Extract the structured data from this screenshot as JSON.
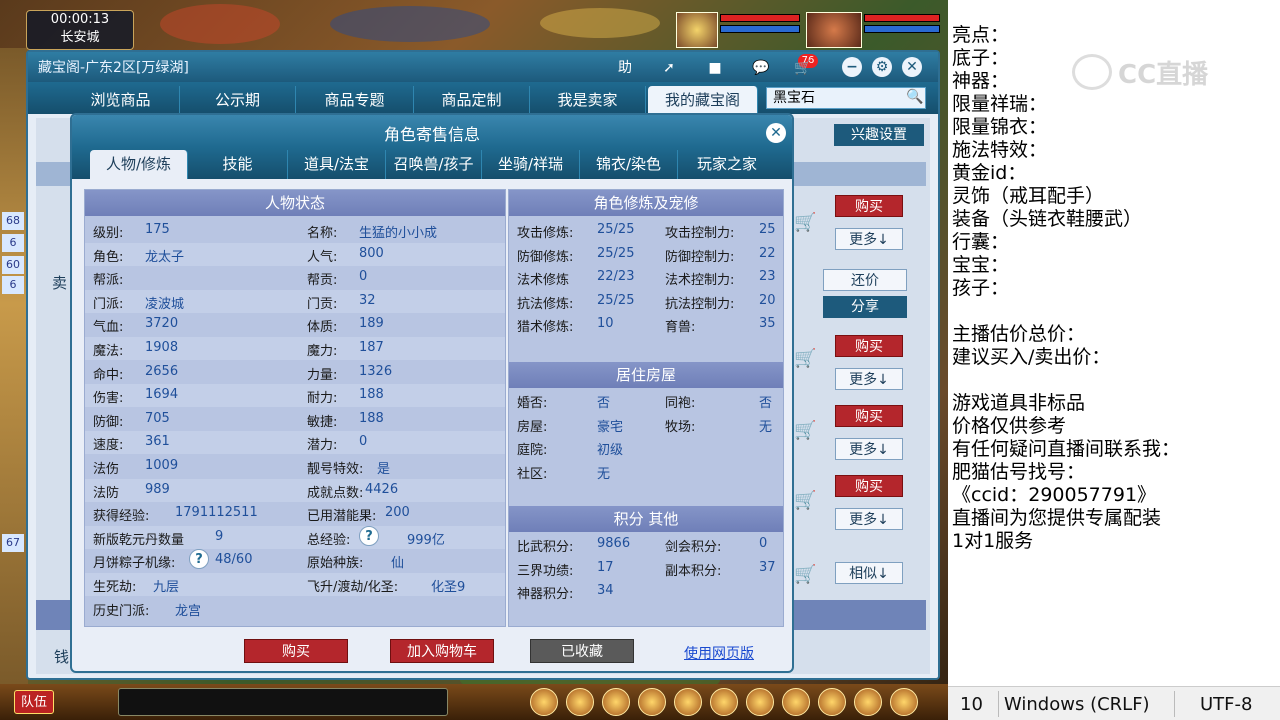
{
  "game": {
    "clock": "00:00:13",
    "location": "长安城",
    "team_button": "队伍",
    "left_strip_numbers": [
      "68",
      "6",
      "60",
      "6",
      "67"
    ]
  },
  "window": {
    "title": "藏宝阁-广东2区[万绿湖]",
    "toolbar": {
      "help": "助",
      "chat_badge": "76"
    },
    "tabs": [
      "浏览商品",
      "公示期",
      "商品专题",
      "商品定制",
      "我是卖家",
      "我的藏宝阁"
    ],
    "active_tab": 5,
    "search_value": "黑宝石",
    "interest_button": "兴趣设置",
    "seller_label": "卖",
    "money_label": "钱",
    "side_buttons": {
      "buy": "购买",
      "more": "更多↓",
      "bargain": "还价",
      "share": "分享",
      "similar": "相似↓"
    }
  },
  "popup": {
    "title": "角色寄售信息",
    "tabs": [
      "人物/修炼",
      "技能",
      "道具/法宝",
      "召唤兽/孩子",
      "坐骑/祥瑞",
      "锦衣/染色",
      "玩家之家"
    ],
    "status_title": "人物状态",
    "status_left": [
      {
        "label": "级别:",
        "value": "175"
      },
      {
        "label": "角色:",
        "value": "龙太子"
      },
      {
        "label": "帮派:",
        "value": ""
      },
      {
        "label": "门派:",
        "value": "凌波城"
      },
      {
        "label": "气血:",
        "value": "3720"
      },
      {
        "label": "魔法:",
        "value": "1908"
      },
      {
        "label": "命中:",
        "value": "2656"
      },
      {
        "label": "伤害:",
        "value": "1694"
      },
      {
        "label": "防御:",
        "value": "705"
      },
      {
        "label": "速度:",
        "value": "361"
      },
      {
        "label": "法伤",
        "value": "1009"
      },
      {
        "label": "法防",
        "value": "989"
      },
      {
        "label": "获得经验:",
        "value": "1791112511"
      },
      {
        "label": "新版乾元丹数量",
        "value": "9"
      },
      {
        "label": "月饼粽子机缘:",
        "value": "48/60"
      },
      {
        "label": "生死劫:",
        "value": "九层"
      },
      {
        "label": "历史门派:",
        "value": "龙宫"
      }
    ],
    "status_right": [
      {
        "label": "名称:",
        "value": "生猛的小小成"
      },
      {
        "label": "人气:",
        "value": "800"
      },
      {
        "label": "帮贡:",
        "value": "0"
      },
      {
        "label": "门贡:",
        "value": "32"
      },
      {
        "label": "体质:",
        "value": "189"
      },
      {
        "label": "魔力:",
        "value": "187"
      },
      {
        "label": "力量:",
        "value": "1326"
      },
      {
        "label": "耐力:",
        "value": "188"
      },
      {
        "label": "敏捷:",
        "value": "188"
      },
      {
        "label": "潜力:",
        "value": "0"
      },
      {
        "label": "靓号特效:",
        "value": "是"
      },
      {
        "label": "成就点数:",
        "value": "4426"
      },
      {
        "label": "已用潜能果:",
        "value": "200"
      },
      {
        "label": "总经验:",
        "value": "999亿"
      },
      {
        "label": "原始种族:",
        "value": "仙"
      },
      {
        "label": "飞升/渡劫/化圣:",
        "value": "化圣9"
      }
    ],
    "help_mark": "?",
    "cultivation_title": "角色修炼及宠修",
    "cultivation": [
      {
        "label": "攻击修炼:",
        "value": "25/25",
        "label2": "攻击控制力:",
        "value2": "25"
      },
      {
        "label": "防御修炼:",
        "value": "25/25",
        "label2": "防御控制力:",
        "value2": "22"
      },
      {
        "label": "法术修炼",
        "value": "22/23",
        "label2": "法术控制力:",
        "value2": "23"
      },
      {
        "label": "抗法修炼:",
        "value": "25/25",
        "label2": "抗法控制力:",
        "value2": "20"
      },
      {
        "label": "猎术修炼:",
        "value": "10",
        "label2": "育兽:",
        "value2": "35"
      }
    ],
    "house_title": "居住房屋",
    "house": [
      {
        "label": "婚否:",
        "value": "否",
        "label2": "同袍:",
        "value2": "否"
      },
      {
        "label": "房屋:",
        "value": "豪宅",
        "label2": "牧场:",
        "value2": "无"
      },
      {
        "label": "庭院:",
        "value": "初级",
        "label2": "",
        "value2": ""
      },
      {
        "label": "社区:",
        "value": "无",
        "label2": "",
        "value2": ""
      }
    ],
    "points_title": "积分 其他",
    "points": [
      {
        "label": "比武积分:",
        "value": "9866",
        "label2": "剑会积分:",
        "value2": "0"
      },
      {
        "label": "三界功绩:",
        "value": "17",
        "label2": "副本积分:",
        "value2": "37"
      },
      {
        "label": "神器积分:",
        "value": "34",
        "label2": "",
        "value2": ""
      }
    ],
    "buttons": {
      "buy": "购买",
      "add_cart": "加入购物车",
      "favorited": "已收藏",
      "web_version": "使用网页版"
    }
  },
  "notepad": {
    "lines": [
      "亮点：",
      "底子：",
      "神器：",
      "限量祥瑞：",
      "限量锦衣：",
      "施法特效：",
      "黄金id：",
      "灵饰（戒耳配手）",
      "装备（头链衣鞋腰武）",
      "行囊：",
      "宝宝：",
      "孩子：",
      "",
      "主播估价总价：",
      "建议买入/卖出价：",
      "",
      "游戏道具非标品",
      "价格仅供参考",
      "有任何疑问直播间联系我：",
      "肥猫估号找号：",
      "《ccid：290057791》",
      "直播间为您提供专属配装",
      "1对1服务"
    ],
    "watermark": "CC直播",
    "status": {
      "position": "10",
      "line_ending": "Windows (CRLF)",
      "encoding": "UTF-8"
    }
  }
}
